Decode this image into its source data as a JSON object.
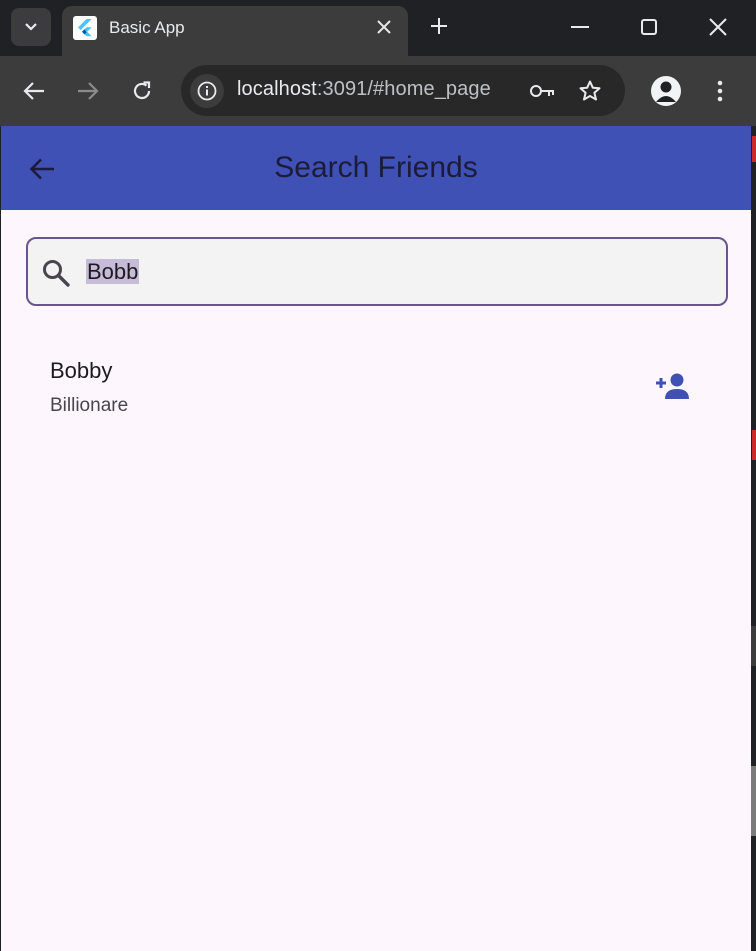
{
  "browser": {
    "tab_title": "Basic App",
    "url_host": "localhost",
    "url_rest": ":3091/#home_page"
  },
  "app": {
    "title": "Search Friends",
    "appbar_color": "#3f51b5",
    "search": {
      "value": "Bobb"
    },
    "results": [
      {
        "name": "Bobby",
        "subtitle": "Billionare"
      }
    ]
  },
  "icons": {
    "back": "arrow-back-icon",
    "search": "search-icon",
    "add_friend": "person-add-icon"
  }
}
